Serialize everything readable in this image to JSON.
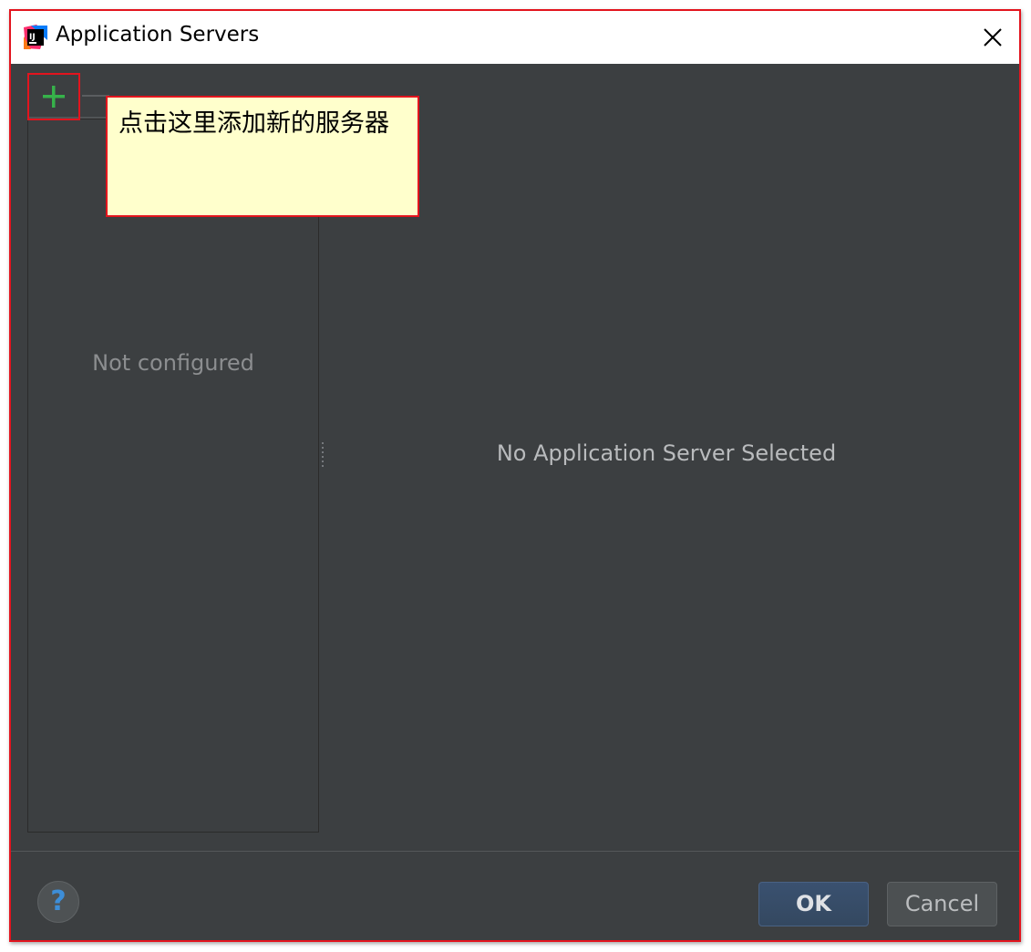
{
  "window": {
    "title": "Application Servers",
    "app_icon": "intellij-idea-icon",
    "close_icon": "close-icon"
  },
  "toolbar": {
    "add_icon": "plus-icon",
    "add_color": "#36b24a"
  },
  "left_panel": {
    "empty_text": "Not configured"
  },
  "main": {
    "empty_text": "No Application Server Selected"
  },
  "callout": {
    "text": "点击这里添加新的服务器"
  },
  "footer": {
    "help_icon": "help-icon",
    "help_glyph": "?",
    "ok_label": "OK",
    "cancel_label": "Cancel"
  },
  "colors": {
    "annotation_border": "#e3141e",
    "callout_background": "#ffffcc",
    "dialog_background": "#3c3f41",
    "ok_button": "#3a5170",
    "help_glyph": "#3d8ed8"
  }
}
